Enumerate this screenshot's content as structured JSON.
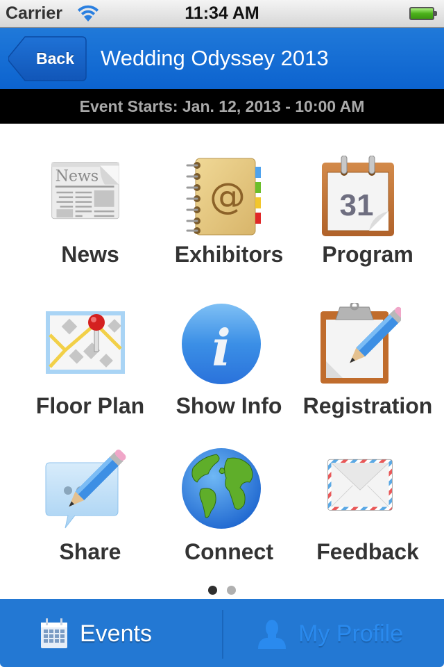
{
  "status_bar": {
    "carrier": "Carrier",
    "time": "11:34 AM",
    "wifi_icon": "wifi-icon",
    "battery_icon": "battery-icon"
  },
  "nav": {
    "back_label": "Back",
    "title": "Wedding Odyssey 2013",
    "color": "#1a6fd6"
  },
  "event_banner": {
    "text": "Event Starts: Jan. 12, 2013 - 10:00 AM"
  },
  "grid": {
    "items": [
      {
        "label": "News",
        "icon": "newspaper-icon"
      },
      {
        "label": "Exhibitors",
        "icon": "address-book-icon"
      },
      {
        "label": "Program",
        "icon": "calendar-icon"
      },
      {
        "label": "Floor Plan",
        "icon": "map-pin-icon"
      },
      {
        "label": "Show Info",
        "icon": "info-icon"
      },
      {
        "label": "Registration",
        "icon": "clipboard-pencil-icon"
      },
      {
        "label": "Share",
        "icon": "speech-bubble-pencil-icon"
      },
      {
        "label": "Connect",
        "icon": "globe-icon"
      },
      {
        "label": "Feedback",
        "icon": "envelope-icon"
      }
    ],
    "calendar_day": "31",
    "newspaper_title": "News"
  },
  "pagination": {
    "current_page": 1,
    "total_pages": 2
  },
  "tab_bar": {
    "tabs": [
      {
        "label": "Events",
        "icon": "calendar-grid-icon",
        "selected": true
      },
      {
        "label": "My Profile",
        "icon": "person-icon",
        "selected": false
      }
    ]
  }
}
